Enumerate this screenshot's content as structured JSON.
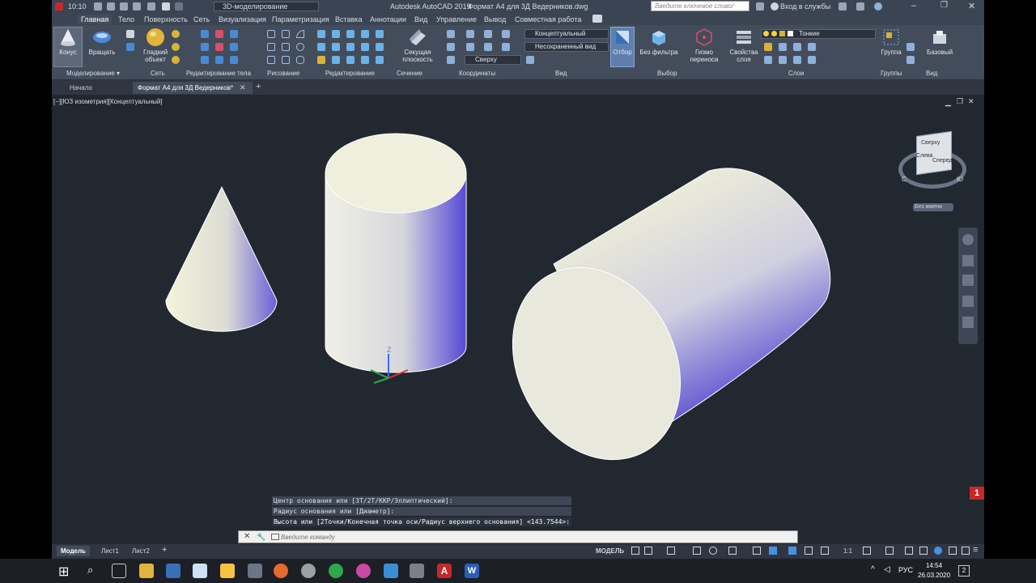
{
  "titlebar": {
    "time": "10:10",
    "workspace": "3D-моделирование",
    "app_title": "Autodesk AutoCAD 2019",
    "file_name": "Формат А4 для 3Д Ведерников.dwg",
    "search_placeholder": "Введите ключевое слово/фразу",
    "signin": "Вход в службы"
  },
  "ribbon_tabs": [
    "Главная",
    "Тело",
    "Поверхность",
    "Сеть",
    "Визуализация",
    "Параметризация",
    "Вставка",
    "Аннотации",
    "Вид",
    "Управление",
    "Вывод",
    "Совместная работа"
  ],
  "ribbon": {
    "cone_label": "Конус",
    "rotate_label": "Вращать",
    "smooth_label1": "Гладкий",
    "smooth_label2": "объект",
    "section_label1": "Секущая",
    "section_label2": "плоскость",
    "visual_style": "Концептуальный",
    "named_view": "Несохраненный вид",
    "ucs_view": "Сверху",
    "select_label": "Отбор",
    "nofilter_label": "Без фильтра",
    "gizmo_label1": "Гизмо",
    "gizmo_label2": "переноса",
    "layerprops_label1": "Свойства",
    "layerprops_label2": "слоя",
    "layer_name": "Тонкие",
    "group_label": "Группа",
    "base_label": "Базовый",
    "panels": {
      "modeling": "Моделирование",
      "mesh": "Сеть",
      "solid_edit": "Редактирование тела",
      "draw": "Рисование",
      "edit": "Редактирование",
      "section": "Сечение",
      "coords": "Координаты",
      "view": "Вид",
      "selection": "Выбор",
      "layers": "Слои",
      "groups": "Группы",
      "view2": "Вид"
    }
  },
  "doc_tabs": [
    "Начало",
    "Формат А4 для 3Д Ведерников*"
  ],
  "viewport": {
    "label": "[−][ЮЗ изометрия][Концептуальный]",
    "viewcube": {
      "top": "Сверху",
      "left": "Слева",
      "front": "Спереди",
      "compass_w": "С",
      "compass_s": "Ю"
    },
    "wcs_label": "Без имени",
    "ucs_axis": "Z"
  },
  "command": {
    "history": [
      "Центр основания или [3Т/2Т/ККР/Эллиптический]:",
      "Радиус основания или [Диаметр]:",
      "Высота или [2Точки/Конечная точка оси/Радиус верхнего основания] <143.7544>:"
    ],
    "placeholder": "Введите команду"
  },
  "layout_tabs": [
    "Модель",
    "Лист1",
    "Лист2"
  ],
  "status": {
    "model": "МОДЕЛЬ",
    "scale": "1:1"
  },
  "taskbar": {
    "lang": "РУС",
    "time": "14:54",
    "date": "26.03.2020",
    "notif": "2"
  },
  "colors": {
    "accent": "#4a90e2",
    "solid_light": "#f0efd6",
    "solid_shadow": "#5a4fd6"
  }
}
